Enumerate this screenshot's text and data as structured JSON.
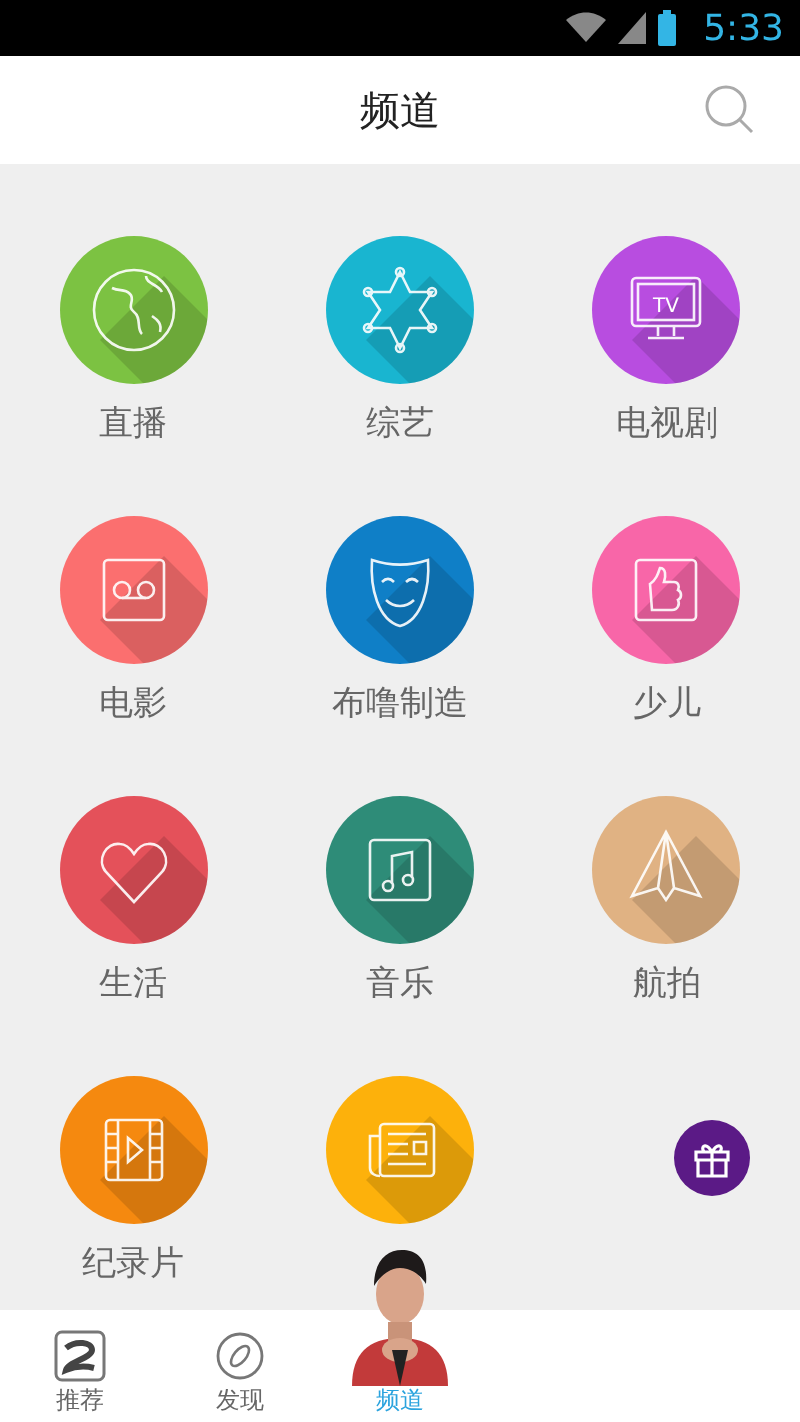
{
  "status_bar": {
    "time": "5:33"
  },
  "header": {
    "title": "频道"
  },
  "channels": [
    {
      "label": "直播",
      "kind": "globe",
      "color": "#7cc242"
    },
    {
      "label": "综艺",
      "kind": "star",
      "color": "#19b5d0"
    },
    {
      "label": "电视剧",
      "kind": "tv",
      "color": "#b84de0",
      "icon_text": "TV"
    },
    {
      "label": "电影",
      "kind": "tape",
      "color": "#fb6f6f"
    },
    {
      "label": "布噜制造",
      "kind": "mask",
      "color": "#0f7fc7"
    },
    {
      "label": "少儿",
      "kind": "thumb",
      "color": "#f866a8"
    },
    {
      "label": "生活",
      "kind": "heart",
      "color": "#e4515a"
    },
    {
      "label": "音乐",
      "kind": "music",
      "color": "#2e8c78"
    },
    {
      "label": "航拍",
      "kind": "pyramid",
      "color": "#e0b283"
    },
    {
      "label": "纪录片",
      "kind": "film",
      "color": "#f5890f"
    },
    {
      "kind": "news",
      "color": "#fdb10b"
    }
  ],
  "gift_button": {
    "kind": "gift"
  },
  "bottom_nav": [
    {
      "label": "推荐",
      "kind": "logo",
      "selected": false
    },
    {
      "label": "发现",
      "kind": "compass",
      "selected": false
    },
    {
      "label": "频道",
      "kind": "picture",
      "selected": true
    }
  ]
}
